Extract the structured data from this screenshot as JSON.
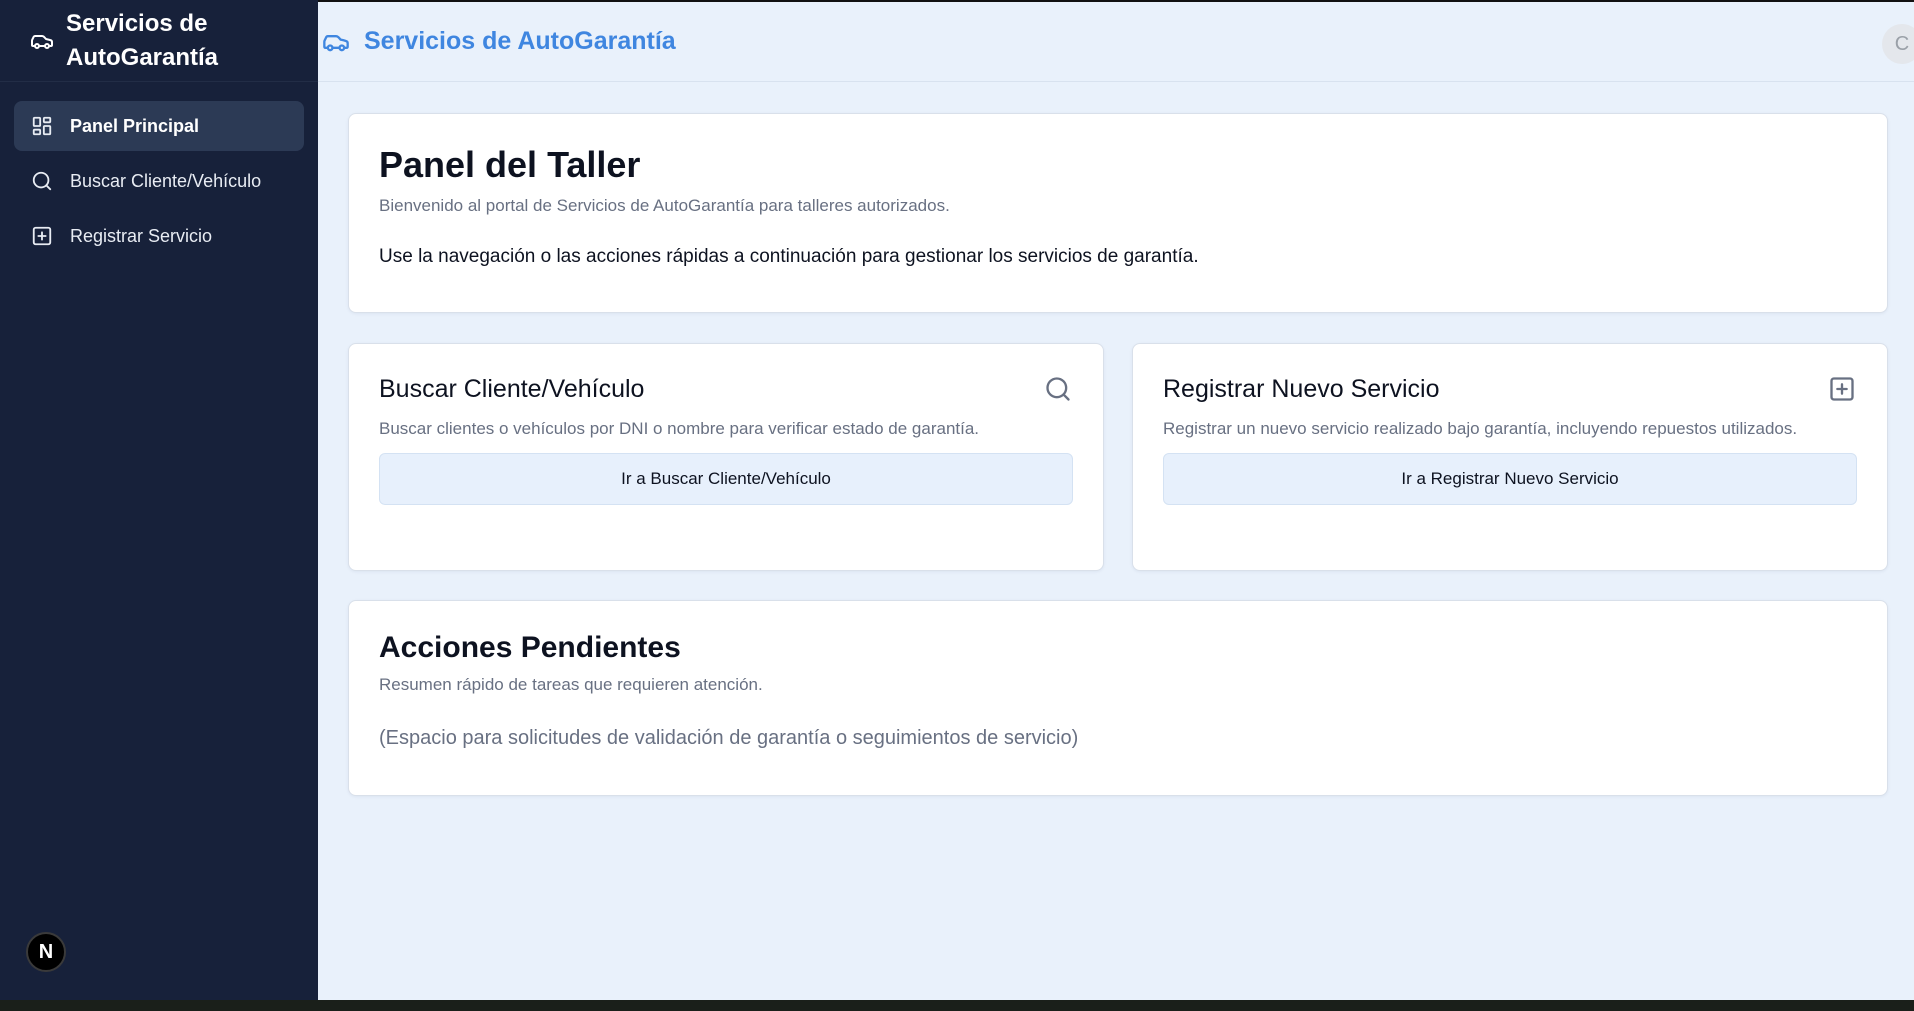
{
  "sidebar": {
    "brand_title": "Servicios de AutoGarantía",
    "brand_icon": "car-icon",
    "items": [
      {
        "label": "Panel Principal",
        "icon": "dashboard-icon",
        "active": true
      },
      {
        "label": "Buscar Cliente/Vehículo",
        "icon": "search-icon",
        "active": false
      },
      {
        "label": "Registrar Servicio",
        "icon": "plus-square-icon",
        "active": false
      }
    ],
    "badge_letter": "N"
  },
  "topbar": {
    "title": "Servicios de AutoGarantía",
    "avatar_letter": "C"
  },
  "hero": {
    "title": "Panel del Taller",
    "subtitle": "Bienvenido al portal de Servicios de AutoGarantía para talleres autorizados.",
    "body": "Use la navegación o las acciones rápidas a continuación para gestionar los servicios de garantía."
  },
  "quick_search": {
    "title": "Buscar Cliente/Vehículo",
    "description": "Buscar clientes o vehículos por DNI o nombre para verificar estado de garantía.",
    "button_label": "Ir a Buscar Cliente/Vehículo"
  },
  "quick_register": {
    "title": "Registrar Nuevo Servicio",
    "description": "Registrar un nuevo servicio realizado bajo garantía, incluyendo repuestos utilizados.",
    "button_label": "Ir a Registrar Nuevo Servicio"
  },
  "pending": {
    "title": "Acciones Pendientes",
    "subtitle": "Resumen rápido de tareas que requieren atención.",
    "body": "(Espacio para solicitudes de validación de garantía o seguimientos de servicio)"
  },
  "colors": {
    "sidebar_bg": "#17213a",
    "main_bg": "#e9f1fb",
    "accent": "#3f86e0",
    "button_bg": "#e7f0fc"
  }
}
